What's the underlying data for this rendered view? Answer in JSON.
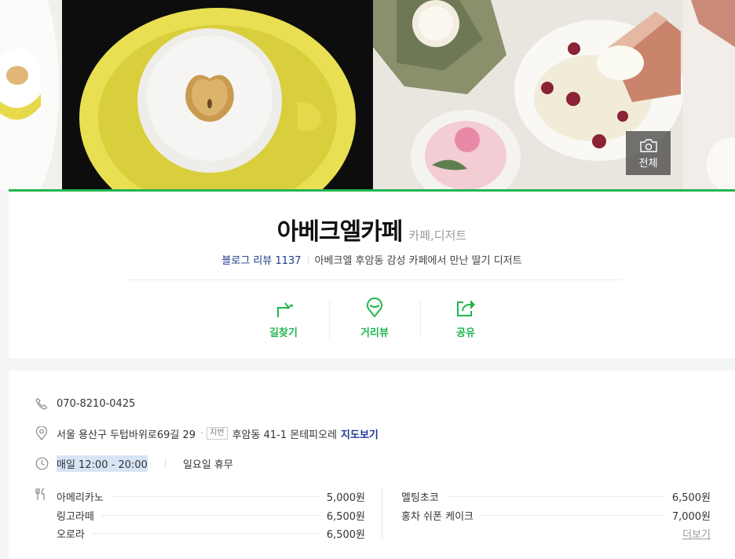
{
  "photos": {
    "view_all_label": "전체"
  },
  "place": {
    "name": "아베크엘카페",
    "category": "카페,디저트",
    "review_label": "블로그 리뷰",
    "review_count": "1137",
    "description": "아베크엘 후암동 감성 카페에서 만난 딸기 디저트"
  },
  "actions": [
    {
      "label": "길찾기",
      "icon": "directions-icon"
    },
    {
      "label": "거리뷰",
      "icon": "street-view-icon"
    },
    {
      "label": "공유",
      "icon": "share-icon"
    }
  ],
  "info": {
    "phone": "070-8210-0425",
    "address": "서울 용산구 두텁바위로69길 29",
    "jibun_tag": "지번",
    "jibun_address": "후암동 41-1 몬테피오레",
    "map_link": "지도보기",
    "hours": "매일 12:00 - 20:00",
    "closed": "일요일 휴무"
  },
  "menu": {
    "left": [
      {
        "name": "아메리카노",
        "price": "5,000원"
      },
      {
        "name": "링고라떼",
        "price": "6,500원"
      },
      {
        "name": "오로라",
        "price": "6,500원"
      }
    ],
    "right": [
      {
        "name": "멜팅초코",
        "price": "6,500원"
      },
      {
        "name": "홍차 쉬폰 케이크",
        "price": "7,000원"
      }
    ],
    "more_label": "더보기"
  },
  "colors": {
    "accent_green": "#21b64f",
    "link_blue": "#1c3a8f"
  }
}
